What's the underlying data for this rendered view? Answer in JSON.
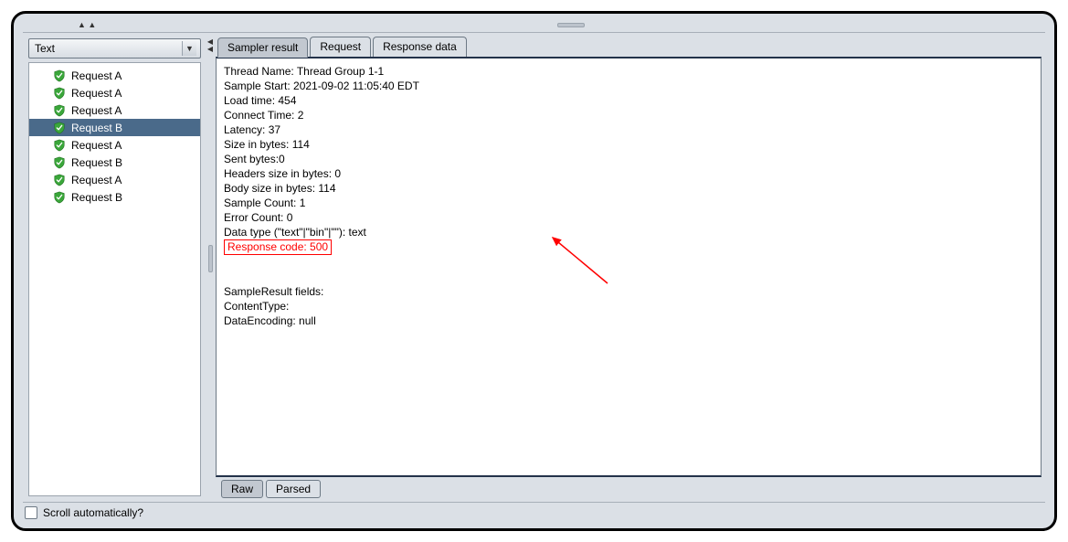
{
  "dropdown": {
    "value": "Text"
  },
  "tree": {
    "items": [
      {
        "label": "Request A",
        "selected": false
      },
      {
        "label": "Request A",
        "selected": false
      },
      {
        "label": "Request A",
        "selected": false
      },
      {
        "label": "Request B",
        "selected": true
      },
      {
        "label": "Request A",
        "selected": false
      },
      {
        "label": "Request B",
        "selected": false
      },
      {
        "label": "Request A",
        "selected": false
      },
      {
        "label": "Request B",
        "selected": false
      }
    ]
  },
  "scroll_checkbox": {
    "label": "Scroll automatically?"
  },
  "tabs": {
    "items": [
      {
        "label": "Sampler result",
        "active": true
      },
      {
        "label": "Request",
        "active": false
      },
      {
        "label": "Response data",
        "active": false
      }
    ]
  },
  "result": {
    "lines": [
      "Thread Name: Thread Group 1-1",
      "Sample Start: 2021-09-02 11:05:40 EDT",
      "Load time: 454",
      "Connect Time: 2",
      "Latency: 37",
      "Size in bytes: 114",
      "Sent bytes:0",
      "Headers size in bytes: 0",
      "Body size in bytes: 114",
      "Sample Count: 1",
      "Error Count: 0",
      "Data type (\"text\"|\"bin\"|\"\"): text"
    ],
    "highlighted": "Response code: 500",
    "lines2": [
      "",
      "",
      "SampleResult fields:",
      "ContentType:",
      "DataEncoding: null"
    ]
  },
  "bottom_tabs": {
    "items": [
      {
        "label": "Raw",
        "active": true
      },
      {
        "label": "Parsed",
        "active": false
      }
    ]
  }
}
